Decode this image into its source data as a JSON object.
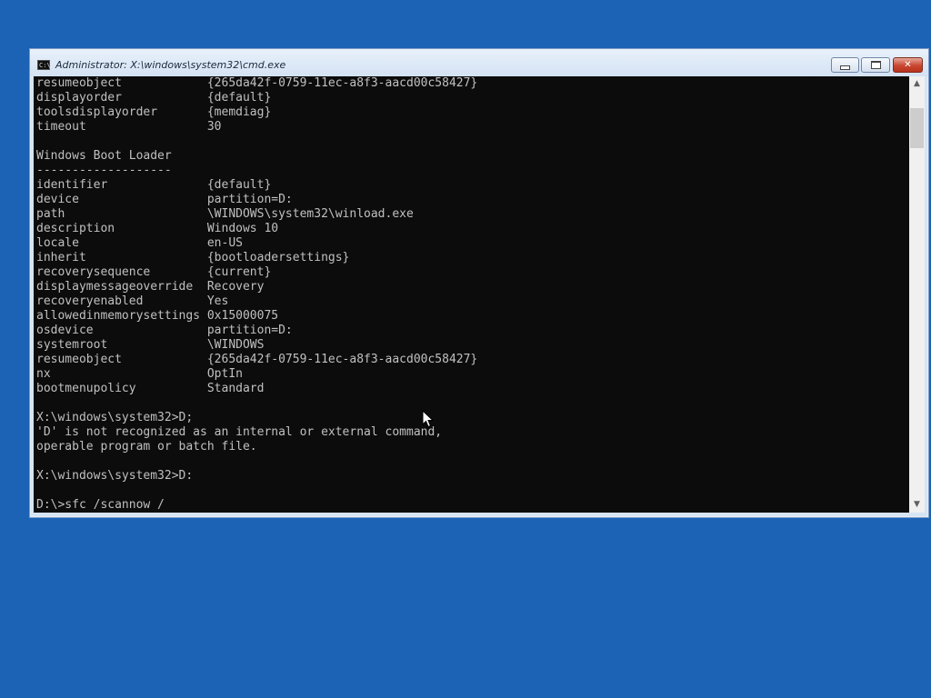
{
  "window": {
    "title": "Administrator: X:\\windows\\system32\\cmd.exe",
    "icon_text": "C:\\.",
    "buttons": {
      "minimize": "minimize-icon",
      "maximize": "maximize-icon",
      "close_label": "✕"
    }
  },
  "console": {
    "lines": [
      "resumeobject            {265da42f-0759-11ec-a8f3-aacd00c58427}",
      "displayorder            {default}",
      "toolsdisplayorder       {memdiag}",
      "timeout                 30",
      "",
      "Windows Boot Loader",
      "-------------------",
      "identifier              {default}",
      "device                  partition=D:",
      "path                    \\WINDOWS\\system32\\winload.exe",
      "description             Windows 10",
      "locale                  en-US",
      "inherit                 {bootloadersettings}",
      "recoverysequence        {current}",
      "displaymessageoverride  Recovery",
      "recoveryenabled         Yes",
      "allowedinmemorysettings 0x15000075",
      "osdevice                partition=D:",
      "systemroot              \\WINDOWS",
      "resumeobject            {265da42f-0759-11ec-a8f3-aacd00c58427}",
      "nx                      OptIn",
      "bootmenupolicy          Standard",
      "",
      "X:\\windows\\system32>D;",
      "'D' is not recognized as an internal or external command,",
      "operable program or batch file.",
      "",
      "X:\\windows\\system32>D:",
      "",
      "D:\\>sfc /scannow /"
    ]
  },
  "colors": {
    "desktop": "#1c62b5",
    "console_bg": "#0c0c0c",
    "console_text": "#c0c0c0"
  }
}
